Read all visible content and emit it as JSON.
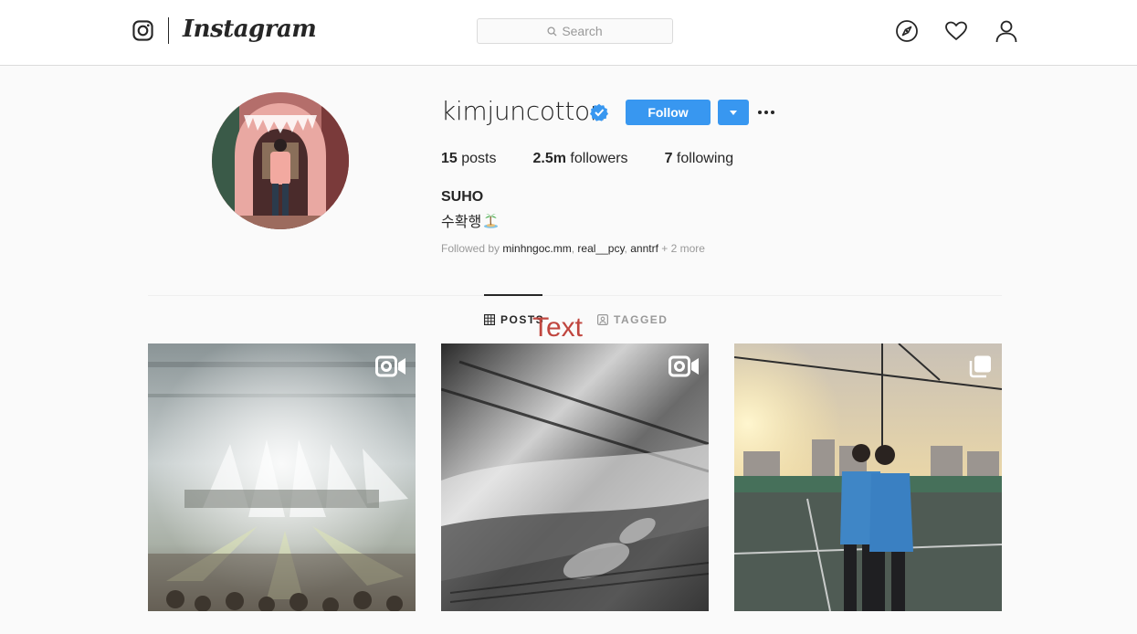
{
  "header": {
    "brand": "Instagram",
    "search_placeholder": "Search",
    "icons": [
      "instagram-logo-icon",
      "search-icon",
      "explore-compass-icon",
      "activity-heart-icon",
      "profile-person-icon"
    ]
  },
  "profile": {
    "username": "kimjuncotton",
    "verified": true,
    "follow_label": "Follow",
    "stats": {
      "posts_count": "15",
      "posts_label": "posts",
      "followers_count": "2.5m",
      "followers_label": "followers",
      "following_count": "7",
      "following_label": "following"
    },
    "full_name": "SUHO",
    "bio": "수확행",
    "bio_emoji": "desert-island-icon",
    "followed_by": {
      "prefix": "Followed by ",
      "names": [
        "minhngoc.mm",
        "real__pcy",
        "anntrf"
      ],
      "sep1": ", ",
      "sep2": ", ",
      "more": " + 2 more"
    }
  },
  "tabs": [
    {
      "label": "POSTS",
      "icon": "grid-icon",
      "active": true
    },
    {
      "label": "TAGGED",
      "icon": "tagged-icon",
      "active": false
    }
  ],
  "overlay_annotation": "Text",
  "posts": [
    {
      "type": "video",
      "description_icon": "video-camera-icon"
    },
    {
      "type": "video",
      "description_icon": "video-camera-icon"
    },
    {
      "type": "carousel",
      "description_icon": "multiple-photos-icon"
    }
  ],
  "colors": {
    "accent": "#3897f0",
    "text": "#262626",
    "muted": "#999999",
    "background": "#fafafa",
    "annotation": "#c0463f"
  }
}
